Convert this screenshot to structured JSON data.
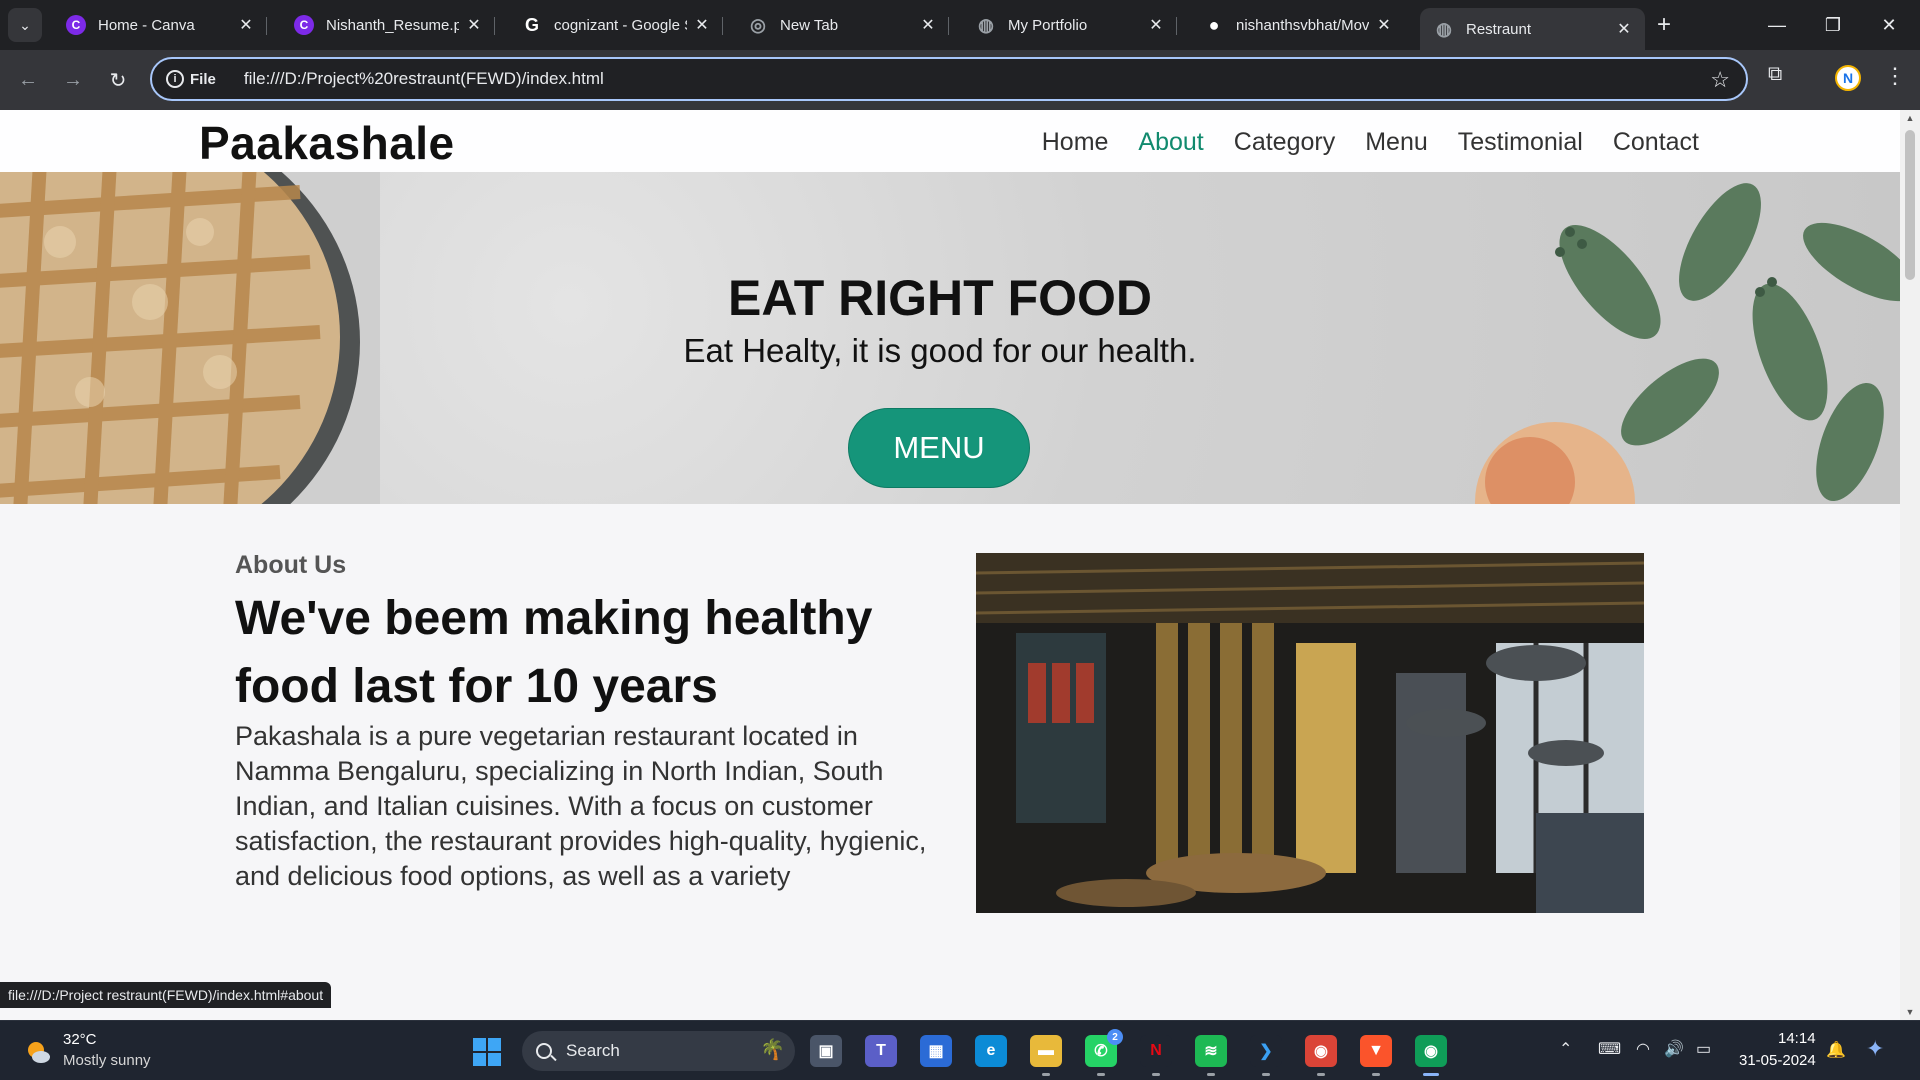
{
  "browser": {
    "tabs": [
      {
        "title": "Home - Canva",
        "favicon": "canva-icon",
        "color": "#7d2ae8",
        "glyph": "C",
        "active": false
      },
      {
        "title": "Nishanth_Resume.pdf",
        "favicon": "canva-icon",
        "color": "#7d2ae8",
        "glyph": "C",
        "active": false
      },
      {
        "title": "cognizant - Google Search",
        "favicon": "google-icon",
        "color": "#ffffff",
        "glyph": "G",
        "active": false
      },
      {
        "title": "New Tab",
        "favicon": "chrome-icon",
        "color": "#9aa0a6",
        "glyph": "◎",
        "active": false
      },
      {
        "title": "My Portfolio",
        "favicon": "globe-icon",
        "color": "#9aa0a6",
        "glyph": "◍",
        "active": false
      },
      {
        "title": "nishanthsvbhat/Movie",
        "favicon": "github-icon",
        "color": "#ffffff",
        "glyph": "●",
        "active": false
      },
      {
        "title": "Restraunt",
        "favicon": "globe-icon",
        "color": "#9aa0a6",
        "glyph": "◍",
        "active": true
      }
    ],
    "new_tab_label": "+",
    "omnibox": {
      "scheme_label": "File",
      "url": "file:///D:/Project%20restraunt(FEWD)/index.html"
    },
    "profile_initial": "N",
    "status_url": "file:///D:/Project restraunt(FEWD)/index.html#about"
  },
  "site": {
    "logo": "Paakashale",
    "nav": [
      {
        "label": "Home",
        "active": false
      },
      {
        "label": "About",
        "active": true
      },
      {
        "label": "Category",
        "active": false
      },
      {
        "label": "Menu",
        "active": false
      },
      {
        "label": "Testimonial",
        "active": false
      },
      {
        "label": "Contact",
        "active": false
      }
    ],
    "hero": {
      "title": "EAT RIGHT FOOD",
      "subtitle": "Eat Healty, it is good for our health.",
      "button": "MENU"
    },
    "about": {
      "kicker": "About Us",
      "heading": "We've beem making healthy food last for 10 years",
      "paragraph": "Pakashala is a pure vegetarian restaurant located in Namma Bengaluru, specializing in North Indian, South Indian, and Italian cuisines. With a focus on customer satisfaction, the restaurant provides high-quality, hygienic, and delicious food options, as well as a variety"
    },
    "accent_color": "#15957a"
  },
  "taskbar": {
    "weather_temp": "32°C",
    "weather_desc": "Mostly sunny",
    "search_label": "Search",
    "apps": [
      {
        "name": "task-view-icon",
        "glyph": "▣",
        "color": "#4a5568"
      },
      {
        "name": "teams-icon",
        "glyph": "T",
        "color": "#5b5fc7"
      },
      {
        "name": "store-icon",
        "glyph": "▦",
        "color": "#2b6bd6"
      },
      {
        "name": "edge-icon",
        "glyph": "e",
        "color": "#0c8bd6"
      },
      {
        "name": "file-explorer-icon",
        "glyph": "▬",
        "color": "#e8b93a"
      },
      {
        "name": "whatsapp-icon",
        "glyph": "✆",
        "color": "#25d366",
        "badge": "2"
      },
      {
        "name": "netflix-icon",
        "glyph": "N",
        "color": "#1f2530",
        "fg": "#e50914"
      },
      {
        "name": "spotify-icon",
        "glyph": "≋",
        "color": "#1db954"
      },
      {
        "name": "vscode-icon",
        "glyph": "❯",
        "color": "#1f2530",
        "fg": "#3aa0f3"
      },
      {
        "name": "chrome-icon",
        "glyph": "◉",
        "color": "#db4437"
      },
      {
        "name": "brave-icon",
        "glyph": "▼",
        "color": "#fb542b"
      },
      {
        "name": "chrome-profile-icon",
        "glyph": "◉",
        "color": "#0f9d58"
      }
    ],
    "time": "14:14",
    "date": "31-05-2024"
  }
}
